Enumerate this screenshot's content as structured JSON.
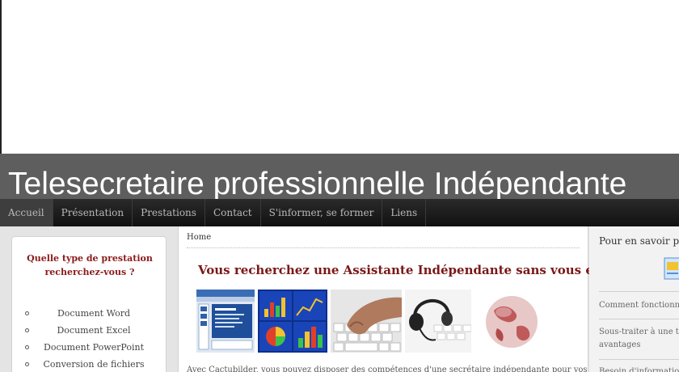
{
  "site": {
    "title": "Telesecretaire professionnelle Indépendante"
  },
  "nav": {
    "items": [
      {
        "label": "Accueil",
        "active": true
      },
      {
        "label": "Présentation"
      },
      {
        "label": "Prestations"
      },
      {
        "label": "Contact"
      },
      {
        "label": "S'informer, se former"
      },
      {
        "label": "Liens"
      }
    ]
  },
  "sidebar": {
    "title": "Quelle type de prestation recherchez-vous ?",
    "items": [
      {
        "label": "Document Word"
      },
      {
        "label": "Document Excel"
      },
      {
        "label": "Document PowerPoint"
      },
      {
        "label": "Conversion de fichiers"
      }
    ]
  },
  "main": {
    "breadcrumb": "Home",
    "heading": "Vous recherchez une Assistante Indépendante sans vous engager ?",
    "intro": "Avec Cactubilder, vous pouvez disposer des compétences d'une secrétaire indépendante pour vos",
    "images": [
      {
        "icon": "powerpoint-screenshot-image"
      },
      {
        "icon": "chart-slides-image"
      },
      {
        "icon": "keyboard-typing-image"
      },
      {
        "icon": "headset-phone-image"
      },
      {
        "icon": "globe-image"
      }
    ]
  },
  "right": {
    "title": "Pour en savoir plus",
    "links": [
      {
        "label": "Comment fonctionne"
      },
      {
        "label": "Sous-traiter à une télé",
        "label2": "avantages"
      },
      {
        "label": "Besoin d'informations"
      }
    ]
  },
  "colors": {
    "banner": "#5e5e5e",
    "nav": "#1a1a1a",
    "accent": "#7a1818"
  }
}
